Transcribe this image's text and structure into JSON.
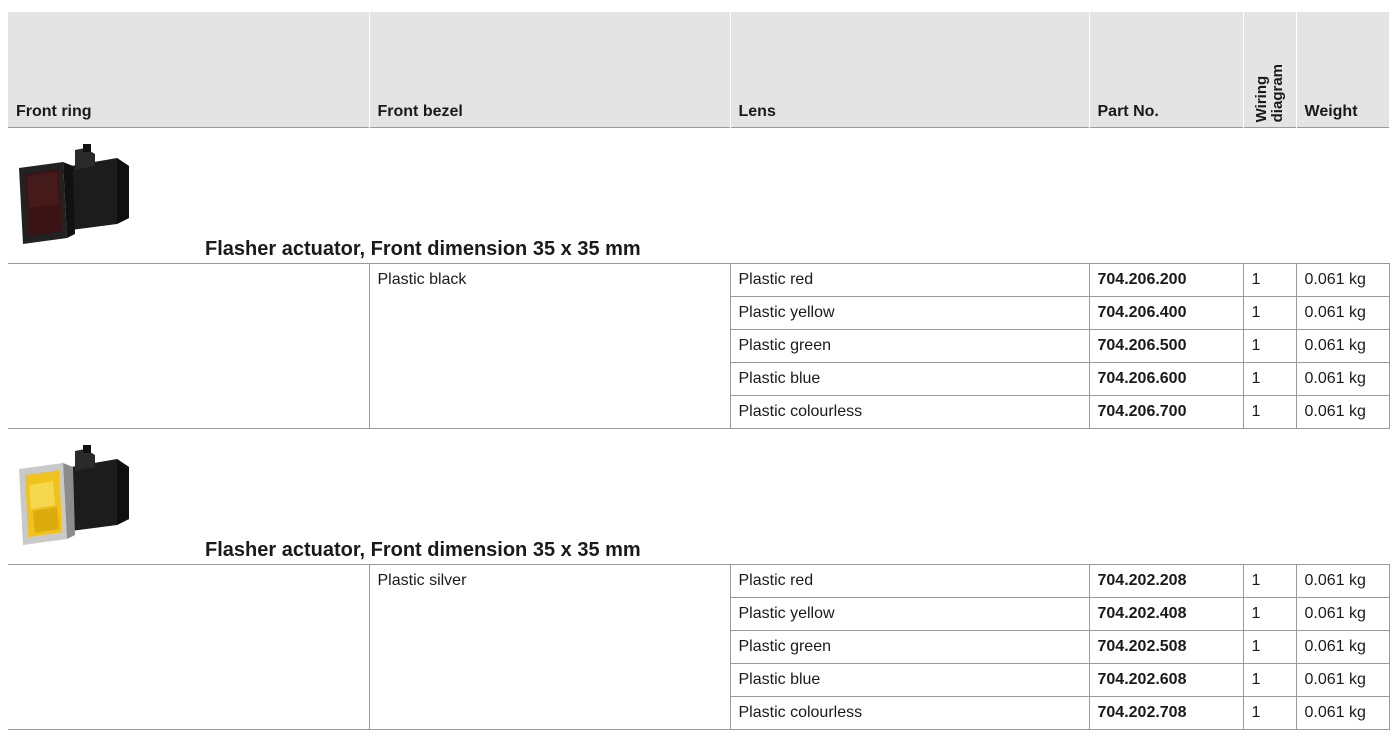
{
  "headers": {
    "front_ring": "Front ring",
    "front_bezel": "Front bezel",
    "lens": "Lens",
    "part_no": "Part No.",
    "wiring_diagram": "Wiring\ndiagram",
    "weight": "Weight"
  },
  "sections": [
    {
      "title": "Flasher actuator, Front dimension 35 x 35 mm",
      "image_icon": "flasher-actuator-black-red-icon",
      "bezel": "Plastic black",
      "rows": [
        {
          "lens": "Plastic red",
          "part_no": "704.206.200",
          "wiring": "1",
          "weight": "0.061 kg"
        },
        {
          "lens": "Plastic yellow",
          "part_no": "704.206.400",
          "wiring": "1",
          "weight": "0.061 kg"
        },
        {
          "lens": "Plastic green",
          "part_no": "704.206.500",
          "wiring": "1",
          "weight": "0.061 kg"
        },
        {
          "lens": "Plastic blue",
          "part_no": "704.206.600",
          "wiring": "1",
          "weight": "0.061 kg"
        },
        {
          "lens": "Plastic colourless",
          "part_no": "704.206.700",
          "wiring": "1",
          "weight": "0.061 kg"
        }
      ]
    },
    {
      "title": "Flasher actuator, Front dimension 35 x 35 mm",
      "image_icon": "flasher-actuator-silver-yellow-icon",
      "bezel": "Plastic silver",
      "rows": [
        {
          "lens": "Plastic red",
          "part_no": "704.202.208",
          "wiring": "1",
          "weight": "0.061 kg"
        },
        {
          "lens": "Plastic yellow",
          "part_no": "704.202.408",
          "wiring": "1",
          "weight": "0.061 kg"
        },
        {
          "lens": "Plastic green",
          "part_no": "704.202.508",
          "wiring": "1",
          "weight": "0.061 kg"
        },
        {
          "lens": "Plastic blue",
          "part_no": "704.202.608",
          "wiring": "1",
          "weight": "0.061 kg"
        },
        {
          "lens": "Plastic colourless",
          "part_no": "704.202.708",
          "wiring": "1",
          "weight": "0.061 kg"
        }
      ]
    }
  ]
}
